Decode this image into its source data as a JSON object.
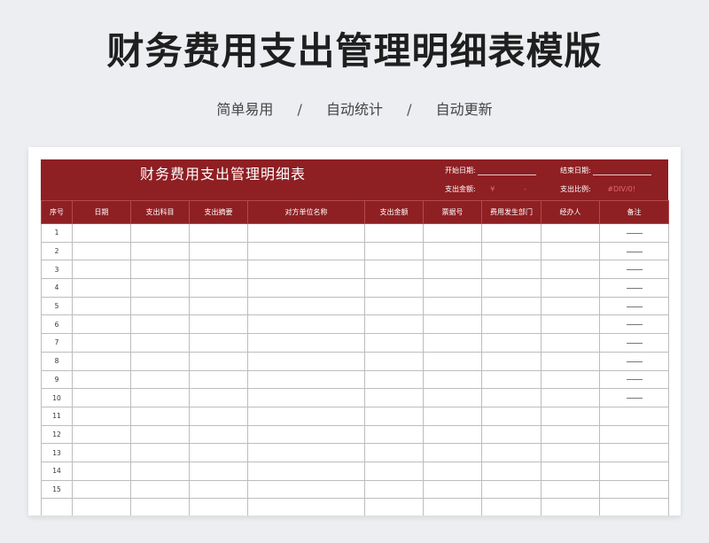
{
  "page": {
    "title": "财务费用支出管理明细表模版",
    "tags": [
      "简单易用",
      "自动统计",
      "自动更新"
    ],
    "tag_separator": "/"
  },
  "sheet": {
    "title": "财务费用支出管理明细表",
    "start_date_label": "开始日期:",
    "end_date_label": "结束日期:",
    "amount_label": "支出金额:",
    "amount_currency": "¥",
    "amount_dash": "-",
    "ratio_label": "支出比例:",
    "ratio_value": "#DIV/0!",
    "columns": [
      "序号",
      "日期",
      "支出科目",
      "支出摘要",
      "对方单位名称",
      "支出金额",
      "票据号",
      "费用发生部门",
      "经办人",
      "备注"
    ],
    "rows": [
      {
        "no": "1",
        "note_dash": true
      },
      {
        "no": "2",
        "note_dash": true
      },
      {
        "no": "3",
        "note_dash": true
      },
      {
        "no": "4",
        "note_dash": true
      },
      {
        "no": "5",
        "note_dash": true
      },
      {
        "no": "6",
        "note_dash": true
      },
      {
        "no": "7",
        "note_dash": true
      },
      {
        "no": "8",
        "note_dash": true
      },
      {
        "no": "9",
        "note_dash": true
      },
      {
        "no": "10",
        "note_dash": true
      },
      {
        "no": "11",
        "note_dash": false
      },
      {
        "no": "12",
        "note_dash": false
      },
      {
        "no": "13",
        "note_dash": false
      },
      {
        "no": "14",
        "note_dash": false
      },
      {
        "no": "15",
        "note_dash": false
      },
      {
        "no": "",
        "note_dash": false
      }
    ]
  },
  "colors": {
    "header_red": "#8e1f23",
    "error_red": "#e36a6d"
  }
}
